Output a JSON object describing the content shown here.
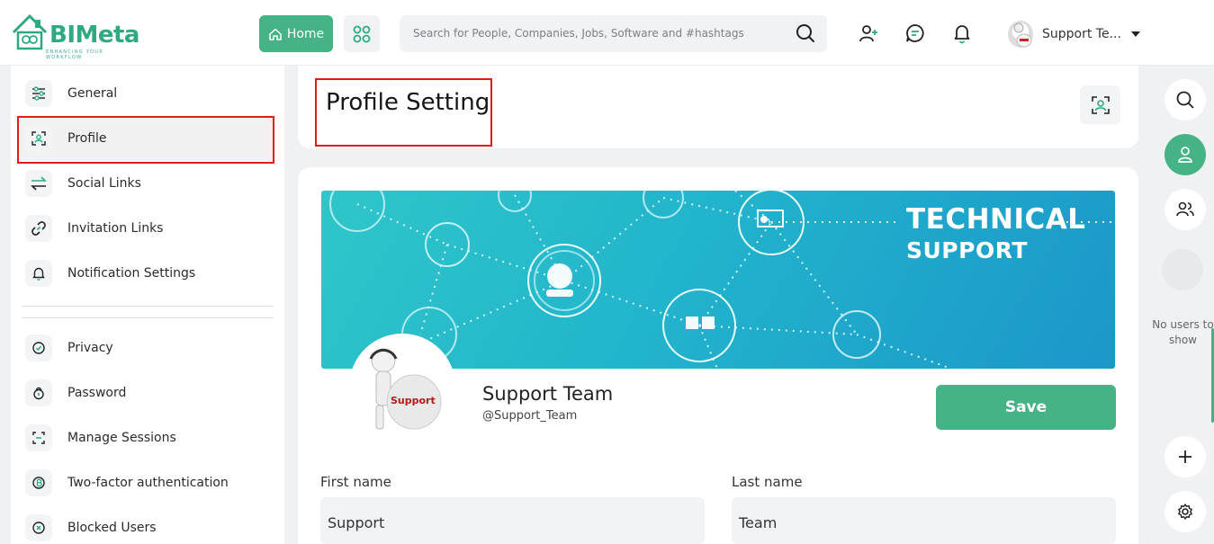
{
  "header": {
    "logo_text": "BIMeta",
    "logo_tagline": "ENHANCING YOUR WORKFLOW",
    "home_label": "Home",
    "search_placeholder": "Search for People, Companies, Jobs, Software and #hashtags",
    "user_name": "Support Te..."
  },
  "sidebar": {
    "items_top": [
      {
        "label": "General",
        "icon": "sliders-icon"
      },
      {
        "label": "Profile",
        "icon": "profile-scan-icon"
      },
      {
        "label": "Social Links",
        "icon": "swap-arrows-icon"
      },
      {
        "label": "Invitation Links",
        "icon": "link-icon"
      },
      {
        "label": "Notification Settings",
        "icon": "bell-icon"
      }
    ],
    "items_bottom": [
      {
        "label": "Privacy",
        "icon": "shield-check-icon"
      },
      {
        "label": "Password",
        "icon": "lock-icon"
      },
      {
        "label": "Manage Sessions",
        "icon": "session-scan-icon"
      },
      {
        "label": "Two-factor authentication",
        "icon": "bitcoin-lock-icon"
      },
      {
        "label": "Blocked Users",
        "icon": "block-icon"
      }
    ]
  },
  "page": {
    "title": "Profile Setting"
  },
  "banner": {
    "title": "TECHNICAL",
    "subtitle": "SUPPORT"
  },
  "profile": {
    "name": "Support Team",
    "handle": "@Support_Team",
    "avatar_text": "Support",
    "save_label": "Save"
  },
  "form": {
    "first_name_label": "First name",
    "first_name_value": "Support",
    "last_name_label": "Last name",
    "last_name_value": "Team"
  },
  "rail": {
    "empty_text": "No users to show"
  },
  "colors": {
    "brand_green": "#45b386",
    "highlight_red": "#e01b1b"
  }
}
